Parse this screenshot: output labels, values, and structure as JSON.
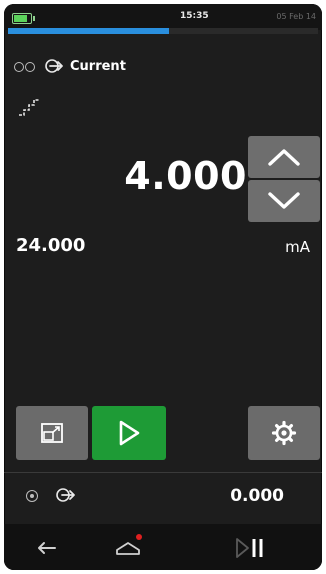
{
  "status_bar": {
    "time": "15:35",
    "date": "05 Feb 14",
    "battery_level": 0.8,
    "battery_color": "#5bd35b"
  },
  "progress": {
    "value": 0.52,
    "color": "#2a8fde"
  },
  "function": {
    "label": "Current",
    "icons": [
      "channel-pair-icon",
      "source-arrow-icon"
    ]
  },
  "mode_icon": "step-ramp-icon",
  "output": {
    "value": "4.000",
    "max_value": "24.000",
    "unit": "mA"
  },
  "spin_buttons": {
    "up_icon": "chevron-up-icon",
    "down_icon": "chevron-down-icon"
  },
  "action_buttons": {
    "zoom_icon": "expand-icon",
    "play_icon": "play-icon",
    "play_color": "#1e9b36",
    "settings_icon": "gear-icon"
  },
  "secondary_channel": {
    "value": "0.000"
  },
  "nav_bar": {
    "back_icon": "back-arrow-icon",
    "home_icon": "home-icon",
    "run_icon": "play-pause-icon",
    "notification_color": "#e02020"
  }
}
